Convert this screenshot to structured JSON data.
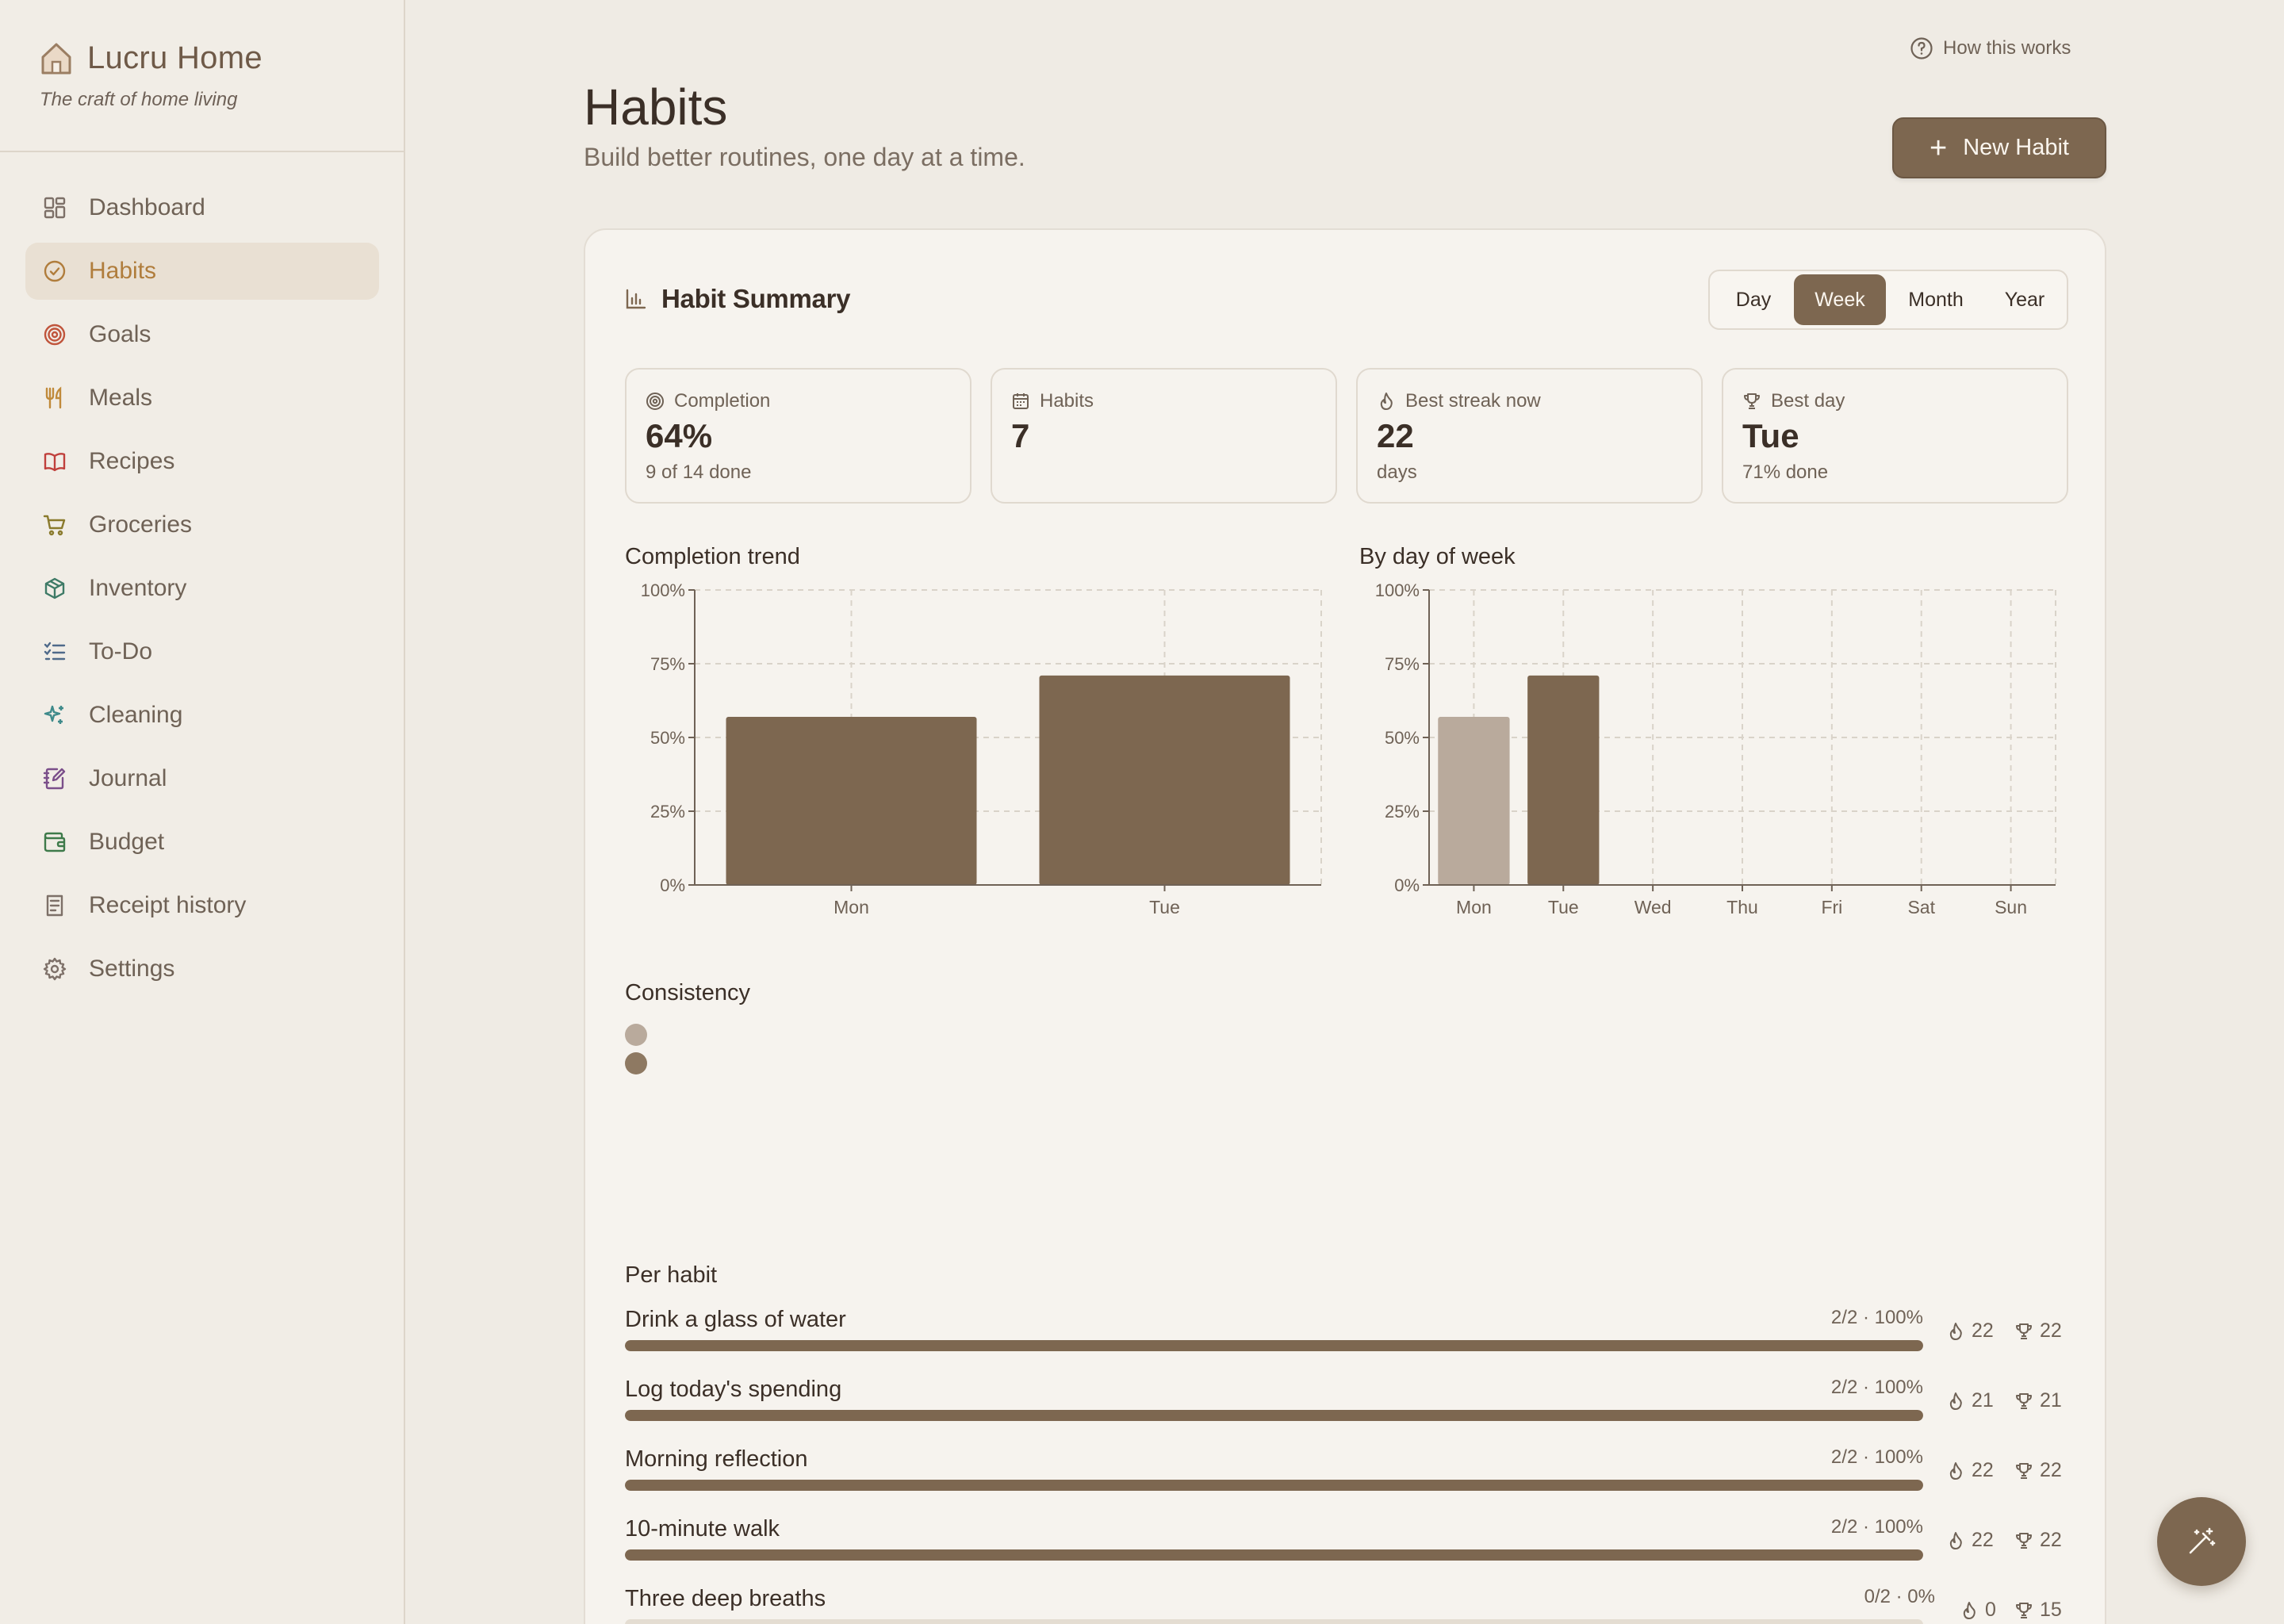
{
  "brand": {
    "title": "Lucru Home",
    "tagline": "The craft of home living"
  },
  "nav": [
    {
      "label": "Dashboard",
      "icon": "dashboard-icon",
      "active": false
    },
    {
      "label": "Habits",
      "icon": "check-circle-icon",
      "active": true
    },
    {
      "label": "Goals",
      "icon": "target-icon",
      "active": false
    },
    {
      "label": "Meals",
      "icon": "utensils-icon",
      "active": false
    },
    {
      "label": "Recipes",
      "icon": "book-icon",
      "active": false
    },
    {
      "label": "Groceries",
      "icon": "cart-icon",
      "active": false
    },
    {
      "label": "Inventory",
      "icon": "package-icon",
      "active": false
    },
    {
      "label": "To-Do",
      "icon": "list-checks-icon",
      "active": false
    },
    {
      "label": "Cleaning",
      "icon": "sparkles-icon",
      "active": false
    },
    {
      "label": "Journal",
      "icon": "notebook-pen-icon",
      "active": false
    },
    {
      "label": "Budget",
      "icon": "wallet-icon",
      "active": false
    },
    {
      "label": "Receipt history",
      "icon": "receipt-icon",
      "active": false
    },
    {
      "label": "Settings",
      "icon": "gear-icon",
      "active": false
    }
  ],
  "header": {
    "help": "How this works",
    "title": "Habits",
    "subtitle": "Build better routines, one day at a time.",
    "new_habit": "New Habit"
  },
  "summary": {
    "title": "Habit Summary",
    "ranges": [
      "Day",
      "Week",
      "Month",
      "Year"
    ],
    "selected_range": "Week",
    "stats": [
      {
        "label": "Completion",
        "value": "64%",
        "sub": "9 of 14 done",
        "icon": "target-icon"
      },
      {
        "label": "Habits",
        "value": "7",
        "sub": "",
        "icon": "calendar-icon"
      },
      {
        "label": "Best streak now",
        "value": "22",
        "sub": "days",
        "icon": "flame-icon"
      },
      {
        "label": "Best day",
        "value": "Tue",
        "sub": "71% done",
        "icon": "trophy-icon"
      }
    ],
    "consistency_title": "Consistency",
    "per_habit_title": "Per habit"
  },
  "chart_data": [
    {
      "type": "bar",
      "title": "Completion trend",
      "categories": [
        "Mon",
        "Tue"
      ],
      "values": [
        57,
        71
      ],
      "yticks": [
        "0%",
        "25%",
        "50%",
        "75%",
        "100%"
      ],
      "ylim": [
        0,
        100
      ],
      "grid": true,
      "colors": {
        "bar": "#7d6750"
      }
    },
    {
      "type": "bar",
      "title": "By day of week",
      "categories": [
        "Mon",
        "Tue",
        "Wed",
        "Thu",
        "Fri",
        "Sat",
        "Sun"
      ],
      "values": [
        57,
        71,
        0,
        0,
        0,
        0,
        0
      ],
      "yticks": [
        "0%",
        "25%",
        "50%",
        "75%",
        "100%"
      ],
      "ylim": [
        0,
        100
      ],
      "grid": true,
      "colors": {
        "bar": "#7d6750",
        "muted": "#b9aa9c"
      },
      "muted_categories": [
        "Mon"
      ]
    }
  ],
  "consistency": {
    "dots": [
      {
        "color": "#b9aa9c"
      },
      {
        "color": "#8e7962"
      }
    ]
  },
  "habits": [
    {
      "name": "Drink a glass of water",
      "stat": "2/2 · 100%",
      "progress": 100,
      "streak": "22",
      "best": "22"
    },
    {
      "name": "Log today's spending",
      "stat": "2/2 · 100%",
      "progress": 100,
      "streak": "21",
      "best": "21"
    },
    {
      "name": "Morning reflection",
      "stat": "2/2 · 100%",
      "progress": 100,
      "streak": "22",
      "best": "22"
    },
    {
      "name": "10-minute walk",
      "stat": "2/2 · 100%",
      "progress": 100,
      "streak": "22",
      "best": "22"
    },
    {
      "name": "Three deep breaths",
      "stat": "0/2 · 0%",
      "progress": 0,
      "streak": "0",
      "best": "15"
    }
  ],
  "colors": {
    "accent": "#7d6750",
    "active_nav": "#b07d3c",
    "background": "#efebe4"
  }
}
